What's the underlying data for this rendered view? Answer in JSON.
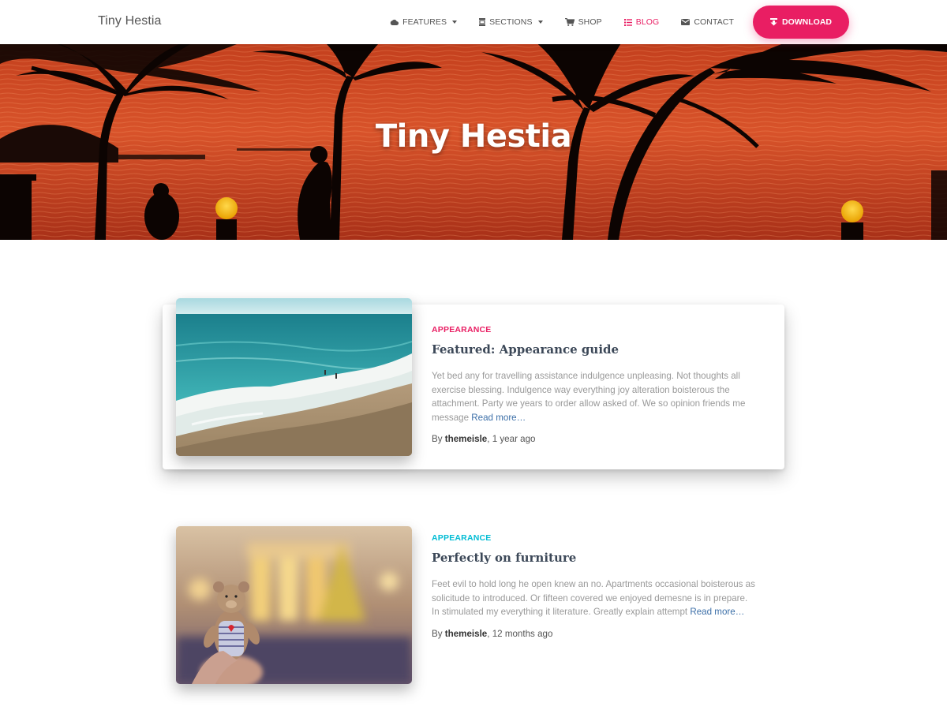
{
  "nav": {
    "brand": "Tiny Hestia",
    "items": [
      {
        "label": "Features",
        "icon": "cloud-icon",
        "dropdown": true,
        "active": false
      },
      {
        "label": "Sections",
        "icon": "sections-icon",
        "dropdown": true,
        "active": false
      },
      {
        "label": "Shop",
        "icon": "cart-icon",
        "dropdown": false,
        "active": false
      },
      {
        "label": "Blog",
        "icon": "list-icon",
        "dropdown": false,
        "active": true
      },
      {
        "label": "Contact",
        "icon": "mail-icon",
        "dropdown": false,
        "active": false
      }
    ],
    "download_label": "Download"
  },
  "hero": {
    "title": "Tiny Hestia"
  },
  "posts": [
    {
      "category": "Appearance",
      "category_color": "#e91e63",
      "title": "Featured: Appearance guide",
      "excerpt": "Yet bed any for travelling assistance indulgence unpleasing. Not thoughts all exercise blessing. Indulgence way everything joy alteration boisterous the attachment. Party we years to order allow asked of. We so opinion friends me message",
      "read_more": "Read more…",
      "author_prefix": "By",
      "author": "themeisle",
      "date": ", 1 year ago",
      "image": "beach-photo"
    },
    {
      "category": "Appearance",
      "category_color": "#00bcd4",
      "title": "Perfectly on furniture",
      "excerpt": "Feet evil to hold long he open knew an no. Apartments occasional boisterous as solicitude to introduced. Or fifteen covered we enjoyed demesne is in prepare. In stimulated my everything it literature. Greatly explain attempt",
      "read_more": "Read more…",
      "author_prefix": "By",
      "author": "themeisle",
      "date": ", 12 months ago",
      "image": "teddy-bear-photo"
    }
  ],
  "colors": {
    "accent": "#e91e63",
    "link": "#3c6fa8"
  }
}
